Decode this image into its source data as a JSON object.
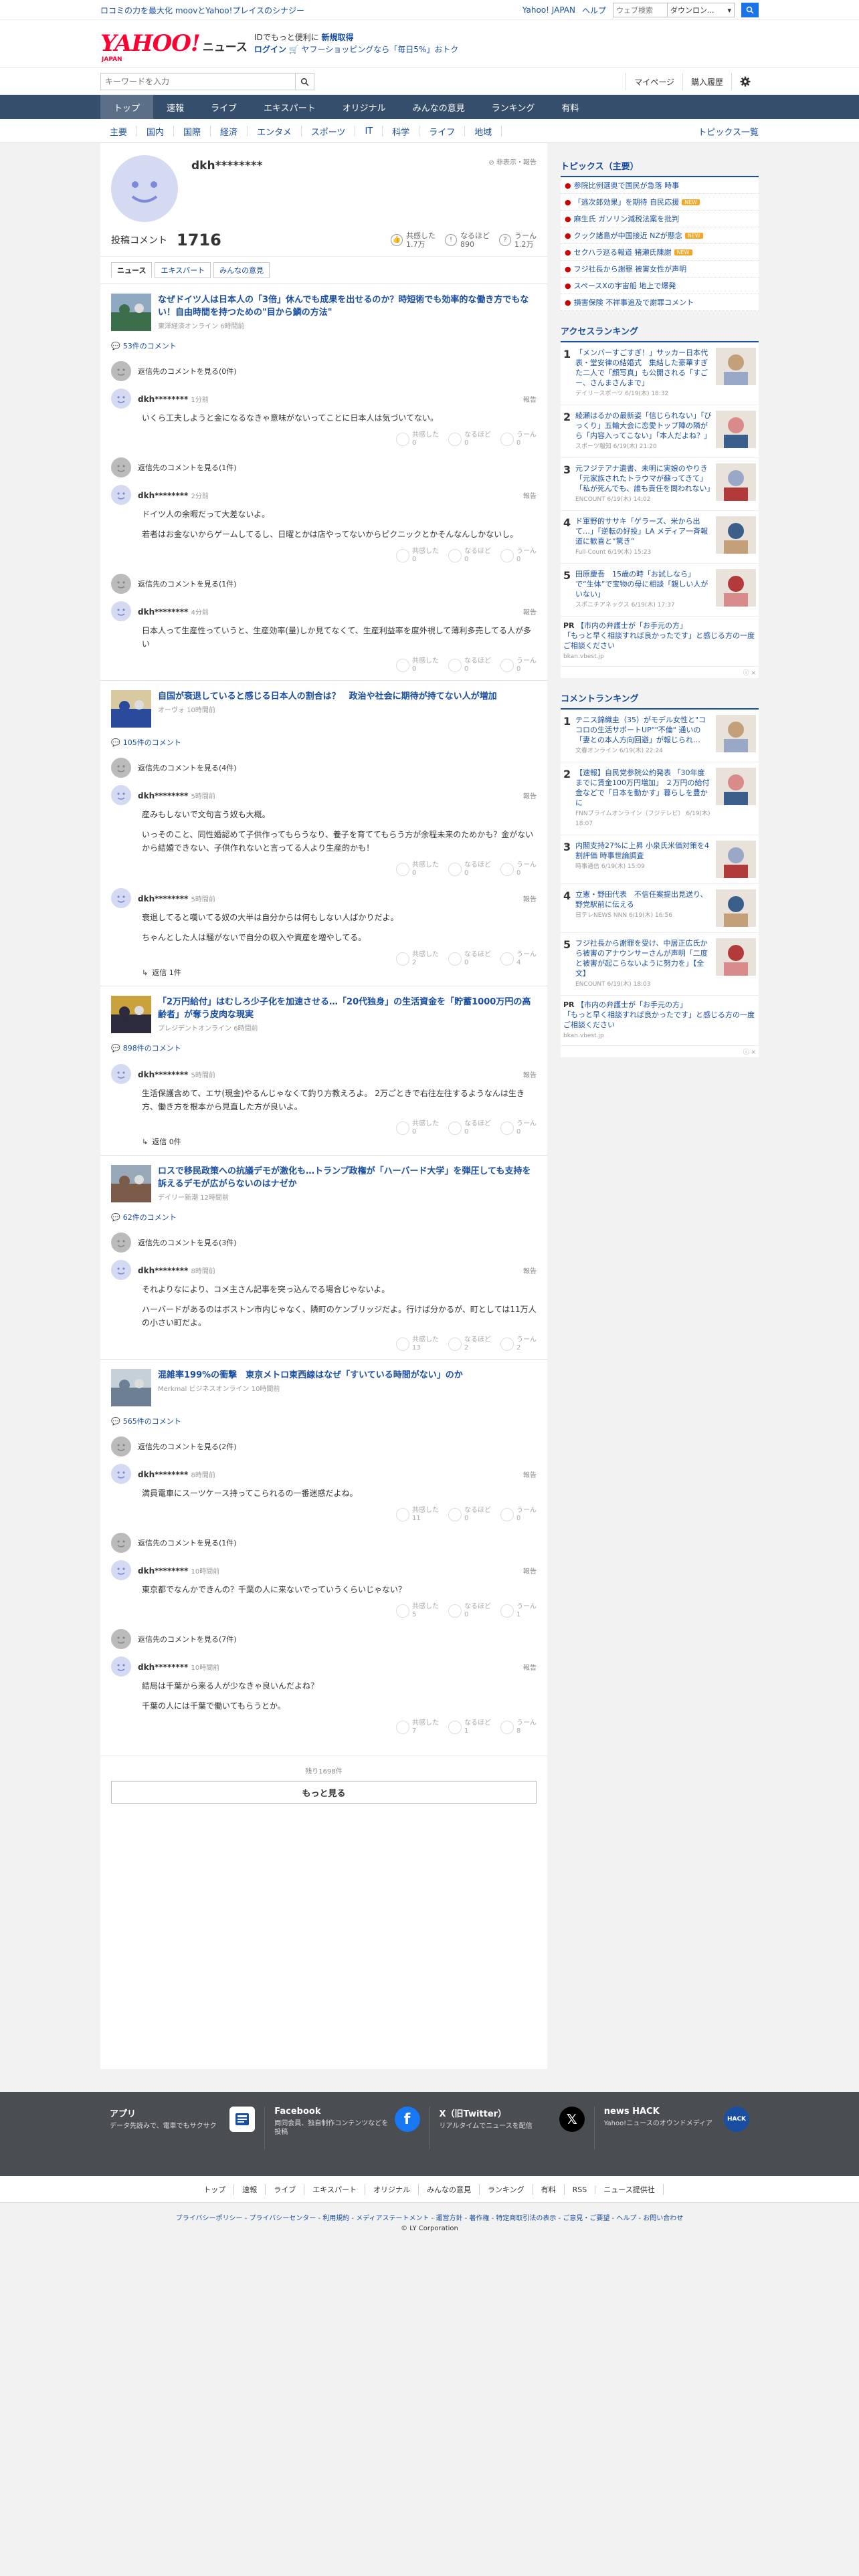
{
  "promo": {
    "text": "ロコミの力を最大化 moovとYahoo!プレイスのシナジー",
    "links": [
      "Yahoo! JAPAN",
      "ヘルプ"
    ],
    "search_placeholder": "ウェブ検索",
    "search_scope": "ダウンロン..."
  },
  "header": {
    "logo": "YAHOO!",
    "logo_sub": "JAPAN",
    "section": "ニュース",
    "line1_a": "IDでもっと便利に",
    "line1_b": "新規取得",
    "line2_a": "ログイン",
    "line2_b": "ヤフーショッピングなら「毎日5%」おトク"
  },
  "search": {
    "placeholder": "キーワードを入力",
    "mypage": "マイページ",
    "history": "購入履歴"
  },
  "nav": [
    "トップ",
    "速報",
    "ライブ",
    "エキスパート",
    "オリジナル",
    "みんなの意見",
    "ランキング",
    "有料"
  ],
  "categories": [
    "主要",
    "国内",
    "国際",
    "経済",
    "エンタメ",
    "スポーツ",
    "IT",
    "科学",
    "ライフ",
    "地域"
  ],
  "topics_list_label": "トピックス一覧",
  "profile": {
    "name": "dkh********",
    "hide_label": "非表示・報告",
    "comments_label": "投稿コメント",
    "comments_count": "1716",
    "agree_label": "共感した",
    "agree_val": "1.7万",
    "insight_label": "なるほど",
    "insight_val": "890",
    "hmm_label": "うーん",
    "hmm_val": "1.2万",
    "tabs": [
      "ニュース",
      "エキスパート",
      "みんなの意見"
    ]
  },
  "labels": {
    "report": "報告",
    "agree": "共感した",
    "insight": "なるほど",
    "hmm": "うーん"
  },
  "articles": [
    {
      "title": "なぜドイツ人は日本人の「3倍」休んでも成果を出せるのか？時短術でも効率的な働き方でもない！自由時間を持つための\"目から鱗の方法\"",
      "source": "東洋経済オンライン",
      "age": "6時間前",
      "count": "53件のコメント",
      "threads": [
        {
          "prev": "返信先のコメントを見る(0件)",
          "time": "1分前",
          "body": [
            "いくら工夫しようと金になるなきゃ意味がないってことに日本人は気づいてない。"
          ],
          "r": [
            "0",
            "0",
            "0"
          ]
        },
        {
          "prev": "返信先のコメントを見る(1件)",
          "time": "2分前",
          "body": [
            "ドイツ人の余暇だって大差ないよ。",
            "若者はお金ないからゲームしてるし、日曜とかは店やってないからピクニックとかそんなんしかないし。"
          ],
          "r": [
            "0",
            "0",
            "0"
          ]
        },
        {
          "prev": "返信先のコメントを見る(1件)",
          "time": "4分前",
          "body": [
            "日本人って生産性っていうと、生産効率(量)しか見てなくて、生産利益率を度外視して薄利多売してる人が多い"
          ],
          "r": [
            "0",
            "0",
            "0"
          ]
        }
      ]
    },
    {
      "title": "自国が衰退していると感じる日本人の割合は？　政治や社会に期待が持てない人が増加",
      "source": "オーヴォ",
      "age": "10時間前",
      "count": "105件のコメント",
      "threads": [
        {
          "prev": "返信先のコメントを見る(4件)",
          "time": "5時間前",
          "body": [
            "産みもしないで文句言う奴も大概。",
            "いっそのこと、同性婚認めて子供作ってもらうなり、養子を育ててもらう方が余程未来のためかも？金がないから結婚できない、子供作れないと言ってる人より生産的かも！"
          ],
          "r": [
            "0",
            "0",
            "0"
          ]
        },
        {
          "prev": "",
          "time": "5時間前",
          "body": [
            "衰退してると嘆いてる奴の大半は自分からは何もしない人ばかりだよ。",
            "ちゃんとした人は騒がないで自分の収入や資産を増やしてる。"
          ],
          "r": [
            "2",
            "0",
            "4"
          ],
          "reply": "返信 1件"
        }
      ]
    },
    {
      "title": "「2万円給付」はむしろ少子化を加速させる…「20代独身」の生活資金を「貯蓄1000万円の高齢者」が奪う皮肉な現実",
      "source": "プレジデントオンライン",
      "age": "6時間前",
      "count": "898件のコメント",
      "threads": [
        {
          "prev": "",
          "time": "5時間前",
          "body": [
            "生活保護含めて、エサ(現金)やるんじゃなくて釣り方教えろよ。 2万ごときで右往左往するようなんは生き方、働き方を根本から見直した方が良いよ。"
          ],
          "r": [
            "0",
            "0",
            "0"
          ],
          "reply": "返信 0件"
        }
      ]
    },
    {
      "title": "ロスで移民政策への抗議デモが激化も…トランプ政権が「ハーバード大学」を弾圧しても支持を訴えるデモが広がらないのはナゼか",
      "source": "デイリー新潮",
      "age": "12時間前",
      "count": "62件のコメント",
      "threads": [
        {
          "prev": "返信先のコメントを見る(3件)",
          "time": "8時間前",
          "body": [
            "それよりなにより、コメ主さん記事を突っ込んでる場合じゃないよ。",
            "ハーバードがあるのはボストン市内じゃなく、隣町のケンブリッジだよ。行けば分かるが、町としては11万人の小さい町だよ。"
          ],
          "r": [
            "13",
            "2",
            "2"
          ]
        }
      ]
    },
    {
      "title": "混雑率199%の衝撃　東京メトロ東西線はなぜ「すいている時間がない」のか",
      "source": "Merkmal",
      "age": "ビジネスオンライン 10時間前",
      "count": "565件のコメント",
      "threads": [
        {
          "prev": "返信先のコメントを見る(2件)",
          "time": "8時間前",
          "body": [
            "満員電車にスーツケース持ってこられるの一番迷惑だよね。"
          ],
          "r": [
            "11",
            "0",
            "0"
          ]
        },
        {
          "prev": "返信先のコメントを見る(1件)",
          "time": "10時間前",
          "body": [
            "東京都でなんかできんの？千葉の人に来ないでっていうくらいじゃない？"
          ],
          "r": [
            "5",
            "0",
            "1"
          ]
        },
        {
          "prev": "返信先のコメントを見る(7件)",
          "time": "10時間前",
          "body": [
            "結局は千葉から来る人が少なきゃ良いんだよね？",
            "千葉の人には千葉で働いてもらうとか。"
          ],
          "r": [
            "7",
            "1",
            "8"
          ]
        }
      ]
    }
  ],
  "rest_label": "残り1698件",
  "more_label": "もっと見る",
  "sidebar": {
    "topics_head": "トピックス（主要）",
    "topics": [
      {
        "t": "参院比例選奥で国民が急落 時事",
        "new": false
      },
      {
        "t": "「逃次郎効果」を期待 自民応援",
        "new": true
      },
      {
        "t": "麻生氏 ガソリン減税法案を批判",
        "new": false
      },
      {
        "t": "クック諸島が中国接近 NZが懸念",
        "new": true
      },
      {
        "t": "セクハラ巡る報道 猪瀬氏陳謝",
        "new": true
      },
      {
        "t": "フジ社長から謝罪 被害女性が声明",
        "new": false
      },
      {
        "t": "スペースXの宇宙船 地上で爆発",
        "new": false
      },
      {
        "t": "損害保険 不祥事追及で謝罪コメント",
        "new": false
      }
    ],
    "new_label": "NEW",
    "access_head": "アクセスランキング",
    "access": [
      {
        "t": "「メンバーすごすぎ！」サッカー日本代表・堂安律の結婚式　集結した豪華すぎた二人で「顔写真」も公開される「すごー、さんまさんまで」",
        "s": "デイリースポーツ 6/19(木) 18:32"
      },
      {
        "t": "綾瀬はるかの最新姿「信じられない」「びっくり」五輪大会に恋愛トップ陣の隣がら「内容入ってこない」「本人だよね？」",
        "s": "スポーツ報知 6/19(木) 21:20"
      },
      {
        "t": "元フジテアナ遺書、未明に実娘のやりき「元家族されたトラウマが蘇ってきて」「私が死んでも、誰も責任を問われない」",
        "s": "ENCOUNT 6/19(木) 14:02"
      },
      {
        "t": "ド軍野的ササキ「ゲラーズ、米から出て…」「逆転の好投」LA メディア一斉報道に歓喜と“驚き”",
        "s": "Full-Count 6/19(木) 15:23"
      },
      {
        "t": "田原慶吾　15歳の時「お試しなら」で“生体”で宝物の母に相談「親しい人がいない」",
        "s": "スポニチアネックス 6/19(木) 17:37"
      }
    ],
    "pr1_title": "【市内の弁護士が「お手元の方」",
    "pr1_sub": "「もっと早く相談すれば良かったです」と感じる方の一度ご相談ください",
    "pr1_url": "bkan.vbest.jp",
    "comment_head": "コメントランキング",
    "cranking": [
      {
        "t": "テニス錦織圭（35）がモデル女性と\"ココロの生活サポートUP\"\"不倫\" 通いの「妻との本人方向回避」が報じられ…",
        "s": "文春オンライン 6/19(木) 22:24"
      },
      {
        "t": "【速報】自民党参院公約発表 「30年度までに賃金100万円増加」 ２万円の給付金などで「日本を動かす」暮らしを豊かに",
        "s": "FNNプライムオンライン（フジテレビ） 6/19(木) 18:07"
      },
      {
        "t": "内閣支持27%に上昇 小泉氏米価対策を4割評価 時事世論調査",
        "s": "時事通信 6/19(木) 15:09"
      },
      {
        "t": "立憲・野田代表　不信任案提出見送り、野党駅前に伝える",
        "s": "日テレNEWS NNN 6/19(木) 16:56"
      },
      {
        "t": "フジ社長から謝罪を受け、中居正広氏から被害のアナウンサーさんが声明「二度と被害が起こらないように努力を」【全文】",
        "s": "ENCOUNT 6/19(木) 18:03"
      }
    ],
    "pr2_title": "【市内の弁護士が「お手元の方」",
    "pr2_sub": "「もっと早く相談すれば良かったです」と感じる方の一度ご相談ください",
    "pr2_url": "bkan.vbest.jp"
  },
  "footer": {
    "blocks": [
      {
        "t": "アプリ",
        "d": "データ先読みで、電車でもサクサク"
      },
      {
        "t": "Facebook",
        "d": "両同会員、独自制作コンテンツなどを投稿"
      },
      {
        "t": "X（旧Twitter）",
        "d": "リアルタイムでニュースを配信"
      },
      {
        "t": "news HACK",
        "d": "Yahoo!ニュースのオウンドメディア"
      }
    ],
    "nav": [
      "トップ",
      "速報",
      "ライブ",
      "エキスパート",
      "オリジナル",
      "みんなの意見",
      "ランキング",
      "有料",
      "RSS",
      "ニュース提供社"
    ],
    "legal": "プライバシーポリシー - プライバシーセンター - 利用規約 - メディアステートメント - 運営方針 - 著作権 - 特定商取引法の表示 - ご意見・ご要望 - ヘルプ - お問い合わせ",
    "copy": "© LY Corporation"
  }
}
